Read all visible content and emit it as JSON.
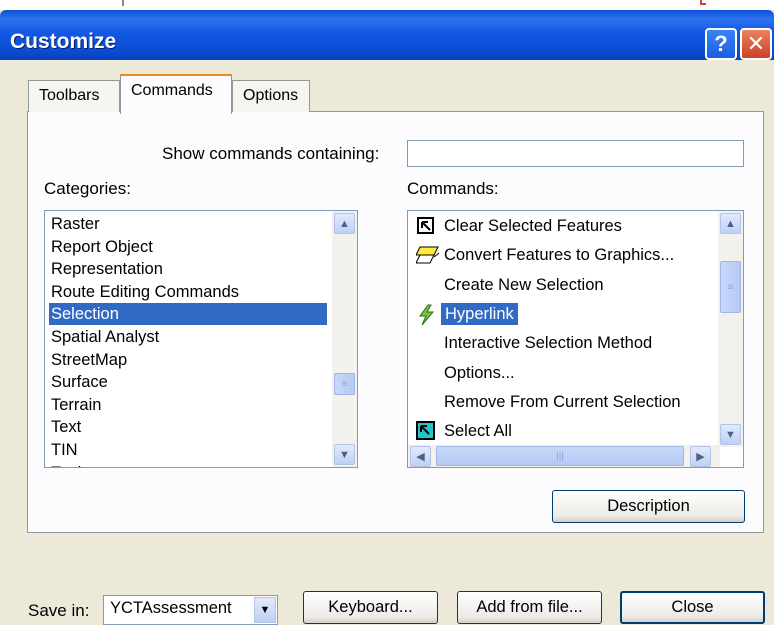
{
  "window": {
    "title": "Customize",
    "help_glyph": "?",
    "close_glyph": "✕"
  },
  "tabs": [
    "Toolbars",
    "Commands",
    "Options"
  ],
  "search": {
    "label": "Show commands containing:",
    "value": ""
  },
  "categories": {
    "label": "Categories:",
    "items": [
      "Raster",
      "Report Object",
      "Representation",
      "Route Editing Commands",
      "Selection",
      "Spatial Analyst",
      "StreetMap",
      "Surface",
      "Terrain",
      "Text",
      "TIN",
      "Tools"
    ],
    "selected": "Selection"
  },
  "commands": {
    "label": "Commands:",
    "items": [
      {
        "label": "Clear Selected Features",
        "icon": "clear-selection-icon"
      },
      {
        "label": "Convert Features to Graphics...",
        "icon": "convert-graphics-icon"
      },
      {
        "label": "Create New Selection",
        "icon": ""
      },
      {
        "label": "Hyperlink",
        "icon": "lightning-icon"
      },
      {
        "label": "Interactive Selection Method",
        "icon": ""
      },
      {
        "label": "Options...",
        "icon": ""
      },
      {
        "label": "Remove From Current Selection",
        "icon": ""
      },
      {
        "label": "Select All",
        "icon": "select-all-icon"
      }
    ],
    "selected": "Hyperlink"
  },
  "buttons": {
    "description": "Description",
    "keyboard": "Keyboard...",
    "add_from_file": "Add from file...",
    "close": "Close"
  },
  "save_in": {
    "label": "Save in:",
    "value": "YCTAssessment"
  }
}
